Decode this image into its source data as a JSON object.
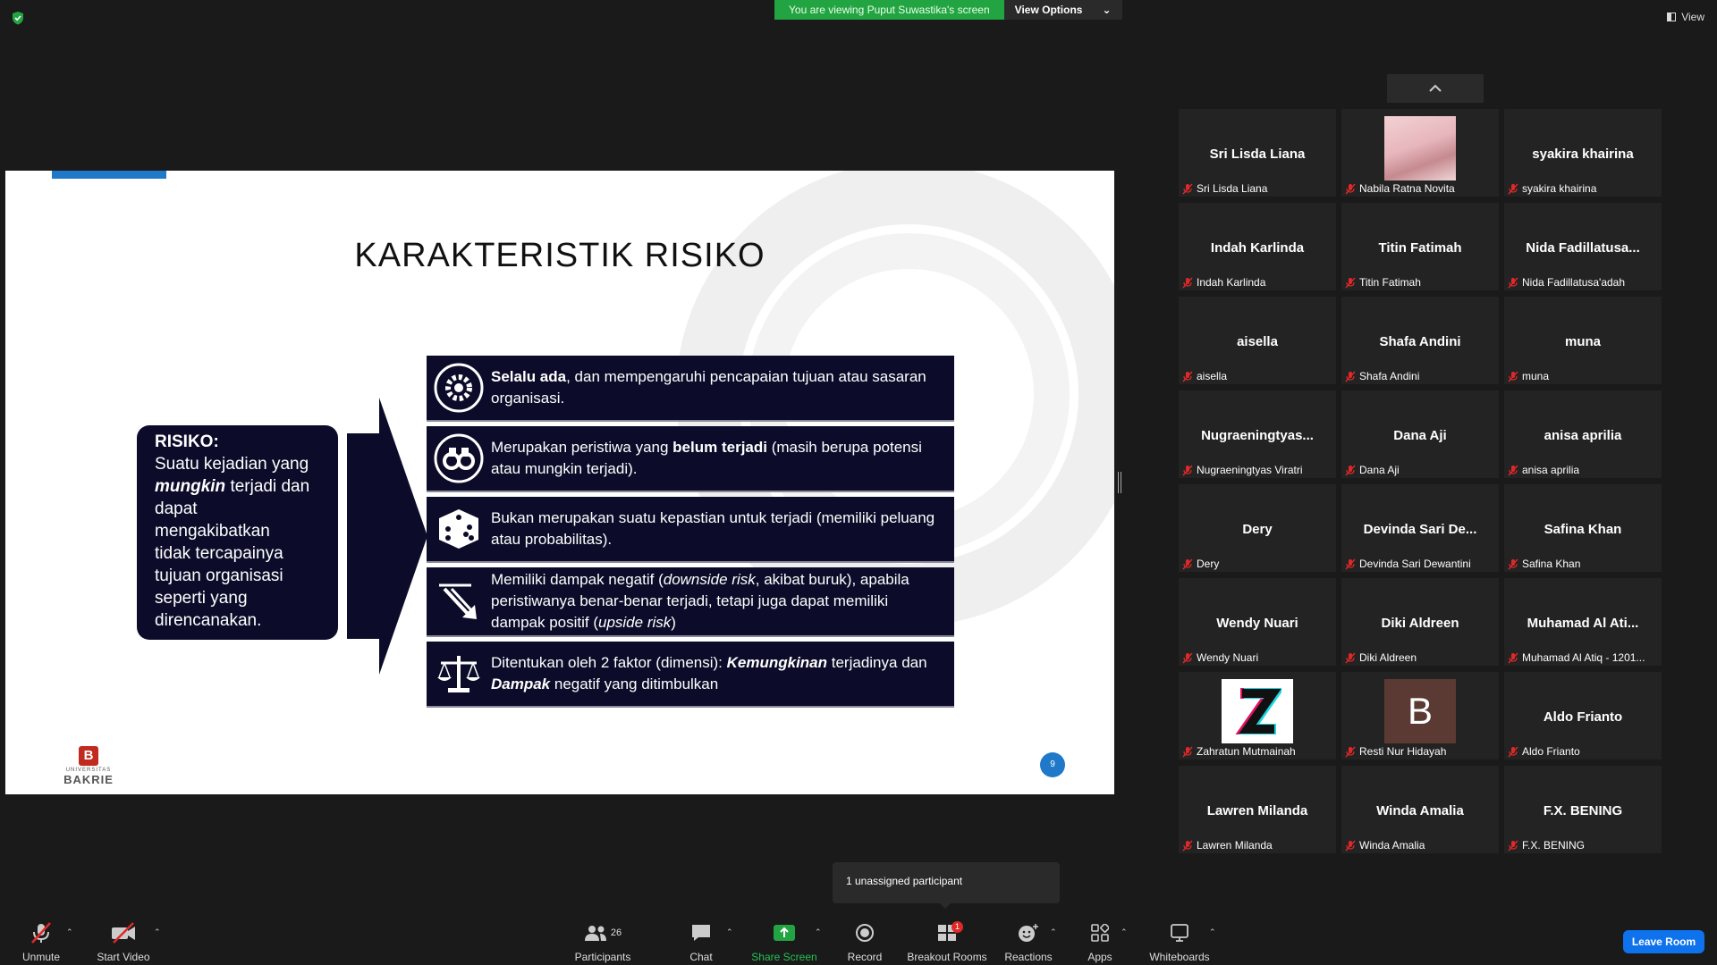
{
  "top": {
    "banner_text": "You are viewing Puput Suwastika's screen",
    "view_options_label": "View Options",
    "view_label": "View"
  },
  "slide": {
    "title": "KARAKTERISTIK RISIKO",
    "risk_box": {
      "heading": "RISIKO:",
      "line1": "Suatu kejadian yang",
      "emph": "mungkin",
      "line2_rest": " terjadi dan",
      "line3": "dapat",
      "line4": "mengakibatkan",
      "line5": "tidak tercapainya",
      "line6": "tujuan organisasi",
      "line7": "seperti yang",
      "line8": "direncanakan."
    },
    "items": [
      {
        "icon": "gear-icon",
        "bold": "Selalu ada",
        "rest": ", dan mempengaruhi pencapaian tujuan atau sasaran organisasi."
      },
      {
        "icon": "binoculars-icon",
        "pre": "Merupakan peristiwa yang ",
        "bold": "belum terjadi",
        "rest": " (masih berupa potensi atau mungkin terjadi)."
      },
      {
        "icon": "dice-icon",
        "text": "Bukan merupakan suatu kepastian untuk terjadi (memiliki peluang atau probabilitas)."
      },
      {
        "icon": "chart-down-icon",
        "pre": "Memiliki dampak negatif (",
        "em1": "downside risk",
        "mid": ", akibat buruk), apabila peristiwanya benar-benar terjadi, tetapi juga dapat memiliki dampak positif (",
        "em2": "upside risk",
        "post": ")"
      },
      {
        "icon": "scale-icon",
        "pre": "Ditentukan oleh 2 faktor (dimensi): ",
        "bold1": "Kemungkinan",
        "mid": " terjadinya dan ",
        "bold2": "Dampak",
        "post": " negatif yang ditimbulkan"
      }
    ],
    "logo_univ": "UNIVERSITAS",
    "logo_name": "BAKRIE",
    "logo_letter": "B",
    "page_number": "9"
  },
  "participants": [
    {
      "big": "Sri Lisda Liana",
      "small": "Sri Lisda Liana"
    },
    {
      "big": "",
      "small": "Nabila Ratna Novita",
      "video": "photo"
    },
    {
      "big": "syakira khairina",
      "small": "syakira khairina"
    },
    {
      "big": "Indah Karlinda",
      "small": "Indah Karlinda"
    },
    {
      "big": "Titin Fatimah",
      "small": "Titin Fatimah"
    },
    {
      "big": "Nida  Fadillatusa...",
      "small": "Nida Fadillatusa'adah"
    },
    {
      "big": "aisella",
      "small": "aisella"
    },
    {
      "big": "Shafa Andini",
      "small": "Shafa Andini"
    },
    {
      "big": "muna",
      "small": "muna"
    },
    {
      "big": "Nugraeningtyas...",
      "small": "Nugraeningtyas Viratri"
    },
    {
      "big": "Dana Aji",
      "small": "Dana Aji"
    },
    {
      "big": "anisa aprilia",
      "small": "anisa aprilia"
    },
    {
      "big": "Dery",
      "small": "Dery"
    },
    {
      "big": "Devinda  Sari  De...",
      "small": "Devinda Sari Dewantini"
    },
    {
      "big": "Safina Khan",
      "small": "Safina Khan"
    },
    {
      "big": "Wendy Nuari",
      "small": "Wendy Nuari"
    },
    {
      "big": "Diki Aldreen",
      "small": "Diki Aldreen"
    },
    {
      "big": "Muhamad  Al  Ati...",
      "small": "Muhamad Al Atiq - 1201..."
    },
    {
      "big": "",
      "small": "Zahratun Mutmainah",
      "video": "z-logo"
    },
    {
      "big": "",
      "small": "Resti Nur Hidayah",
      "video": "letter",
      "letter": "B"
    },
    {
      "big": "Aldo Frianto",
      "small": "Aldo Frianto"
    },
    {
      "big": "Lawren Milanda",
      "small": "Lawren Milanda"
    },
    {
      "big": "Winda Amalia",
      "small": "Winda Amalia"
    },
    {
      "big": "F.X. BENING",
      "small": "F.X. BENING"
    }
  ],
  "popup_text": "1 unassigned participant",
  "toolbar": {
    "unmute": "Unmute",
    "start_video": "Start Video",
    "participants": "Participants",
    "participants_count": "26",
    "chat": "Chat",
    "share_screen": "Share Screen",
    "record": "Record",
    "breakout_rooms": "Breakout Rooms",
    "breakout_badge": "1",
    "reactions": "Reactions",
    "apps": "Apps",
    "whiteboards": "Whiteboards",
    "leave": "Leave Room"
  },
  "colors": {
    "banner_green": "#23a442",
    "slide_navy": "#0c0c2a",
    "accent_blue": "#1f78c8",
    "leave_blue": "#0e72ed",
    "mic_red": "#e02828"
  }
}
